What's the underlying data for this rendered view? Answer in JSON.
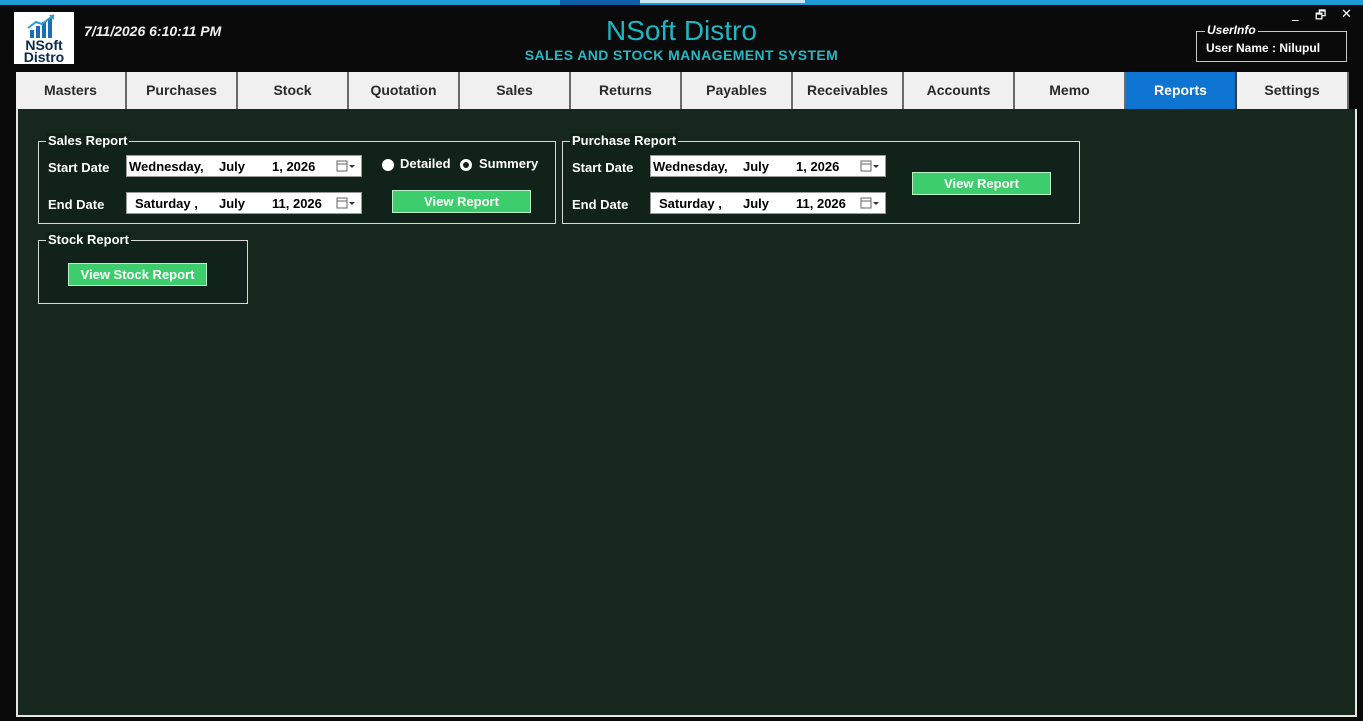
{
  "app": {
    "logo_line1": "NSoft",
    "logo_line2": "Distro",
    "datetime": "7/11/2026 6:10:11 PM",
    "title": "NSoft Distro",
    "subtitle": "SALES AND STOCK MANAGEMENT SYSTEM"
  },
  "userinfo": {
    "legend": "UserInfo",
    "user_name_text": "User Name : Nilupul"
  },
  "window_controls": {
    "minimize": "_",
    "restore": "🗗",
    "close": "✕"
  },
  "tabs": [
    {
      "label": "Masters"
    },
    {
      "label": "Purchases"
    },
    {
      "label": "Stock"
    },
    {
      "label": "Quotation"
    },
    {
      "label": "Sales"
    },
    {
      "label": "Returns"
    },
    {
      "label": "Payables"
    },
    {
      "label": "Receivables"
    },
    {
      "label": "Accounts"
    },
    {
      "label": "Memo"
    },
    {
      "label": "Reports",
      "active": true
    },
    {
      "label": "Settings"
    }
  ],
  "sales_report": {
    "title": "Sales Report",
    "start_label": "Start Date",
    "start": {
      "day": "Wednesday,",
      "month": "July",
      "date": "1, 2026"
    },
    "end_label": "End Date",
    "end": {
      "day": "Saturday ,",
      "month": "July",
      "date": "11, 2026"
    },
    "radio_detailed": "Detailed",
    "radio_summery": "Summery",
    "selected_option": "Summery",
    "button": "View Report"
  },
  "purchase_report": {
    "title": "Purchase Report",
    "start_label": "Start Date",
    "start": {
      "day": "Wednesday,",
      "month": "July",
      "date": "1, 2026"
    },
    "end_label": "End Date",
    "end": {
      "day": "Saturday ,",
      "month": "July",
      "date": "11, 2026"
    },
    "button": "View Report"
  },
  "stock_report": {
    "title": "Stock Report",
    "button": "View Stock Report"
  },
  "colors": {
    "accent_title": "#1fb6c2",
    "active_tab": "#0d74d1",
    "button_green": "#3dcd6c",
    "content_bg": "#16271e"
  },
  "icons": [
    "app-logo-chart-icon",
    "calendar-icon",
    "dropdown-arrow-icon",
    "minimize-icon",
    "restore-icon",
    "close-icon"
  ]
}
